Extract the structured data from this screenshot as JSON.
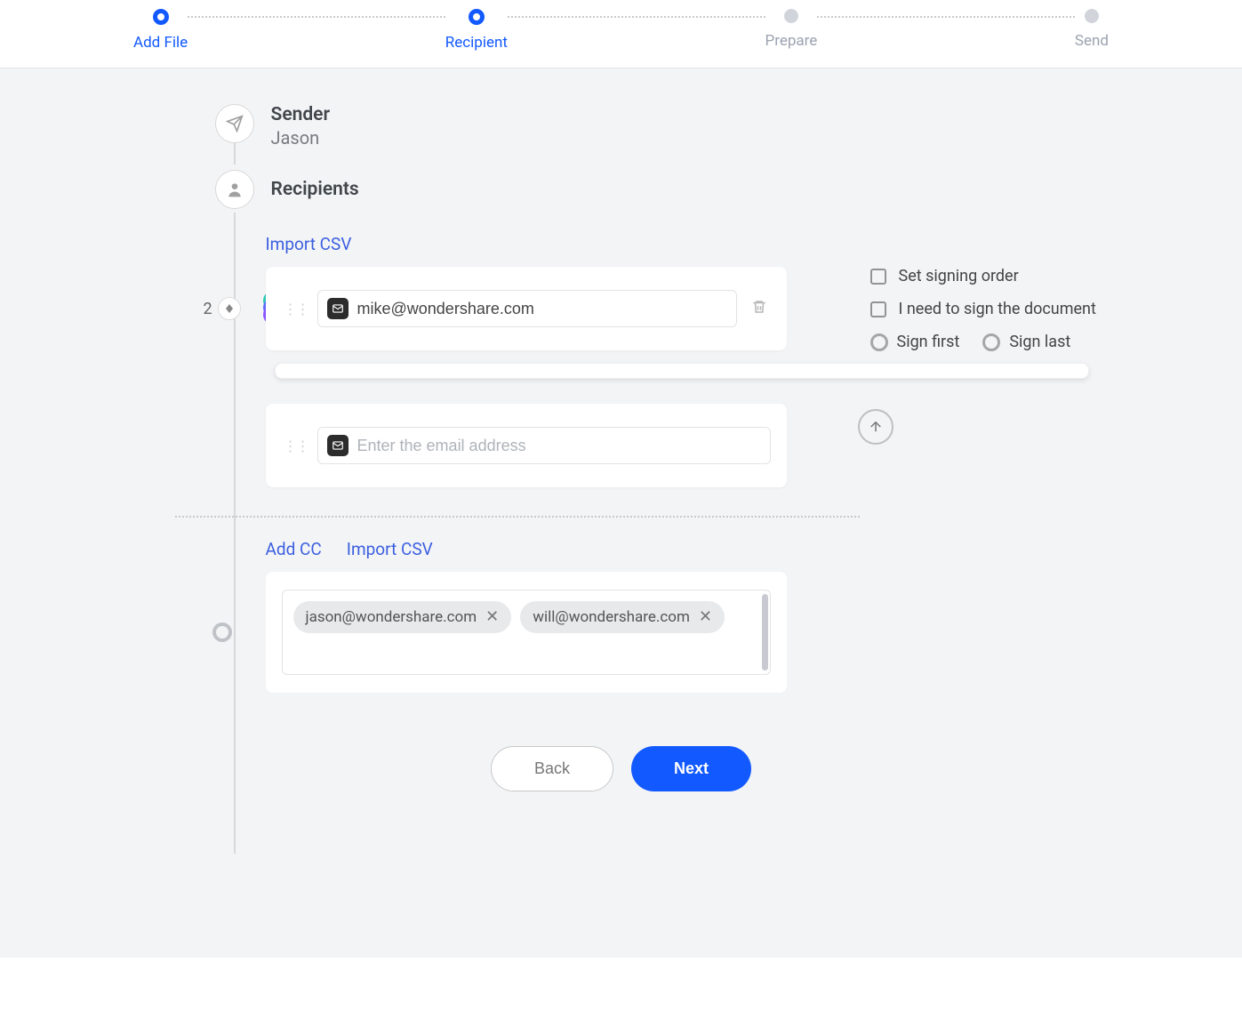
{
  "stepper": {
    "steps": [
      {
        "label": "Add File",
        "active": true
      },
      {
        "label": "Recipient",
        "active": true
      },
      {
        "label": "Prepare",
        "active": false
      },
      {
        "label": "Send",
        "active": false
      }
    ]
  },
  "sender": {
    "title": "Sender",
    "name": "Jason"
  },
  "recipients": {
    "title": "Recipients",
    "import_csv_label": "Import CSV",
    "order_group_count": "2",
    "fields": [
      {
        "value": "mike@wondershare.com",
        "deletable": true
      },
      {
        "placeholder": "Enter the email address",
        "value": ""
      }
    ]
  },
  "options": {
    "set_signing_order": "Set signing order",
    "i_need_to_sign": "I need to sign the document",
    "sign_first": "Sign first",
    "sign_last": "Sign last"
  },
  "cc": {
    "add_cc_label": "Add CC",
    "import_csv_label": "Import CSV",
    "chips": [
      "jason@wondershare.com",
      "will@wondershare.com"
    ]
  },
  "footer": {
    "back_label": "Back",
    "next_label": "Next"
  }
}
